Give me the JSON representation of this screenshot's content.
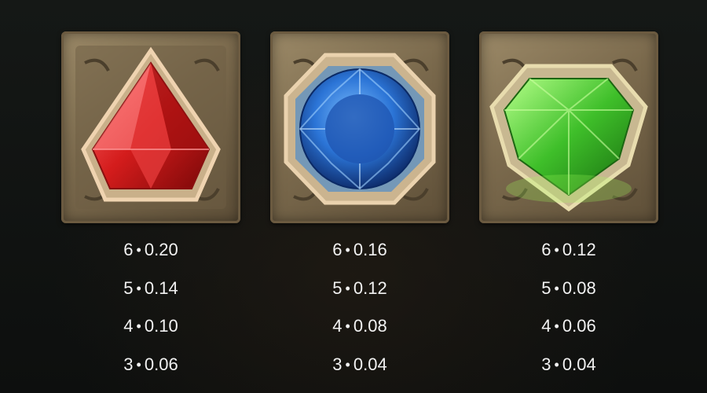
{
  "symbols": [
    {
      "name": "red-gem",
      "color": "#d41c1c",
      "payouts": [
        {
          "count": "6",
          "value": "0.20"
        },
        {
          "count": "5",
          "value": "0.14"
        },
        {
          "count": "4",
          "value": "0.10"
        },
        {
          "count": "3",
          "value": "0.06"
        }
      ]
    },
    {
      "name": "blue-gem",
      "color": "#2b74d6",
      "payouts": [
        {
          "count": "6",
          "value": "0.16"
        },
        {
          "count": "5",
          "value": "0.12"
        },
        {
          "count": "4",
          "value": "0.08"
        },
        {
          "count": "3",
          "value": "0.04"
        }
      ]
    },
    {
      "name": "green-gem",
      "color": "#3fbf2a",
      "payouts": [
        {
          "count": "6",
          "value": "0.12"
        },
        {
          "count": "5",
          "value": "0.08"
        },
        {
          "count": "4",
          "value": "0.06"
        },
        {
          "count": "3",
          "value": "0.04"
        }
      ]
    }
  ],
  "separator": "•"
}
